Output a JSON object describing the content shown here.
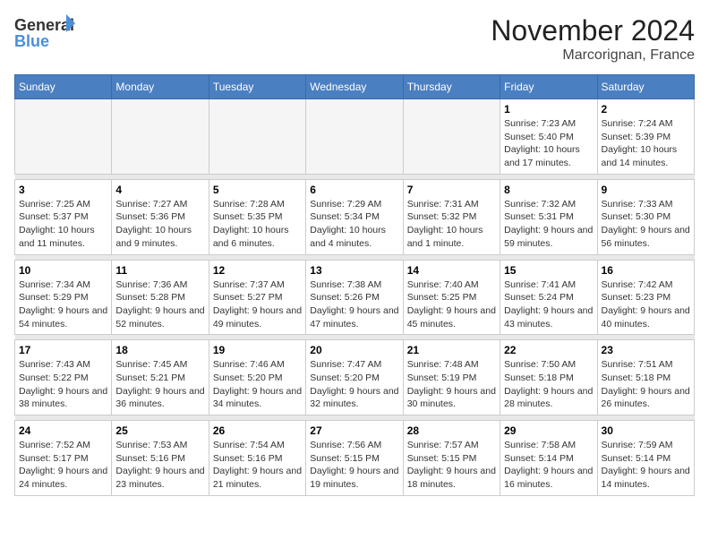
{
  "logo": {
    "line1": "General",
    "line2": "Blue"
  },
  "title": "November 2024",
  "location": "Marcorignan, France",
  "days_of_week": [
    "Sunday",
    "Monday",
    "Tuesday",
    "Wednesday",
    "Thursday",
    "Friday",
    "Saturday"
  ],
  "weeks": [
    {
      "days": [
        {
          "num": "",
          "info": ""
        },
        {
          "num": "",
          "info": ""
        },
        {
          "num": "",
          "info": ""
        },
        {
          "num": "",
          "info": ""
        },
        {
          "num": "",
          "info": ""
        },
        {
          "num": "1",
          "info": "Sunrise: 7:23 AM\nSunset: 5:40 PM\nDaylight: 10 hours and 17 minutes."
        },
        {
          "num": "2",
          "info": "Sunrise: 7:24 AM\nSunset: 5:39 PM\nDaylight: 10 hours and 14 minutes."
        }
      ]
    },
    {
      "days": [
        {
          "num": "3",
          "info": "Sunrise: 7:25 AM\nSunset: 5:37 PM\nDaylight: 10 hours and 11 minutes."
        },
        {
          "num": "4",
          "info": "Sunrise: 7:27 AM\nSunset: 5:36 PM\nDaylight: 10 hours and 9 minutes."
        },
        {
          "num": "5",
          "info": "Sunrise: 7:28 AM\nSunset: 5:35 PM\nDaylight: 10 hours and 6 minutes."
        },
        {
          "num": "6",
          "info": "Sunrise: 7:29 AM\nSunset: 5:34 PM\nDaylight: 10 hours and 4 minutes."
        },
        {
          "num": "7",
          "info": "Sunrise: 7:31 AM\nSunset: 5:32 PM\nDaylight: 10 hours and 1 minute."
        },
        {
          "num": "8",
          "info": "Sunrise: 7:32 AM\nSunset: 5:31 PM\nDaylight: 9 hours and 59 minutes."
        },
        {
          "num": "9",
          "info": "Sunrise: 7:33 AM\nSunset: 5:30 PM\nDaylight: 9 hours and 56 minutes."
        }
      ]
    },
    {
      "days": [
        {
          "num": "10",
          "info": "Sunrise: 7:34 AM\nSunset: 5:29 PM\nDaylight: 9 hours and 54 minutes."
        },
        {
          "num": "11",
          "info": "Sunrise: 7:36 AM\nSunset: 5:28 PM\nDaylight: 9 hours and 52 minutes."
        },
        {
          "num": "12",
          "info": "Sunrise: 7:37 AM\nSunset: 5:27 PM\nDaylight: 9 hours and 49 minutes."
        },
        {
          "num": "13",
          "info": "Sunrise: 7:38 AM\nSunset: 5:26 PM\nDaylight: 9 hours and 47 minutes."
        },
        {
          "num": "14",
          "info": "Sunrise: 7:40 AM\nSunset: 5:25 PM\nDaylight: 9 hours and 45 minutes."
        },
        {
          "num": "15",
          "info": "Sunrise: 7:41 AM\nSunset: 5:24 PM\nDaylight: 9 hours and 43 minutes."
        },
        {
          "num": "16",
          "info": "Sunrise: 7:42 AM\nSunset: 5:23 PM\nDaylight: 9 hours and 40 minutes."
        }
      ]
    },
    {
      "days": [
        {
          "num": "17",
          "info": "Sunrise: 7:43 AM\nSunset: 5:22 PM\nDaylight: 9 hours and 38 minutes."
        },
        {
          "num": "18",
          "info": "Sunrise: 7:45 AM\nSunset: 5:21 PM\nDaylight: 9 hours and 36 minutes."
        },
        {
          "num": "19",
          "info": "Sunrise: 7:46 AM\nSunset: 5:20 PM\nDaylight: 9 hours and 34 minutes."
        },
        {
          "num": "20",
          "info": "Sunrise: 7:47 AM\nSunset: 5:20 PM\nDaylight: 9 hours and 32 minutes."
        },
        {
          "num": "21",
          "info": "Sunrise: 7:48 AM\nSunset: 5:19 PM\nDaylight: 9 hours and 30 minutes."
        },
        {
          "num": "22",
          "info": "Sunrise: 7:50 AM\nSunset: 5:18 PM\nDaylight: 9 hours and 28 minutes."
        },
        {
          "num": "23",
          "info": "Sunrise: 7:51 AM\nSunset: 5:18 PM\nDaylight: 9 hours and 26 minutes."
        }
      ]
    },
    {
      "days": [
        {
          "num": "24",
          "info": "Sunrise: 7:52 AM\nSunset: 5:17 PM\nDaylight: 9 hours and 24 minutes."
        },
        {
          "num": "25",
          "info": "Sunrise: 7:53 AM\nSunset: 5:16 PM\nDaylight: 9 hours and 23 minutes."
        },
        {
          "num": "26",
          "info": "Sunrise: 7:54 AM\nSunset: 5:16 PM\nDaylight: 9 hours and 21 minutes."
        },
        {
          "num": "27",
          "info": "Sunrise: 7:56 AM\nSunset: 5:15 PM\nDaylight: 9 hours and 19 minutes."
        },
        {
          "num": "28",
          "info": "Sunrise: 7:57 AM\nSunset: 5:15 PM\nDaylight: 9 hours and 18 minutes."
        },
        {
          "num": "29",
          "info": "Sunrise: 7:58 AM\nSunset: 5:14 PM\nDaylight: 9 hours and 16 minutes."
        },
        {
          "num": "30",
          "info": "Sunrise: 7:59 AM\nSunset: 5:14 PM\nDaylight: 9 hours and 14 minutes."
        }
      ]
    }
  ]
}
